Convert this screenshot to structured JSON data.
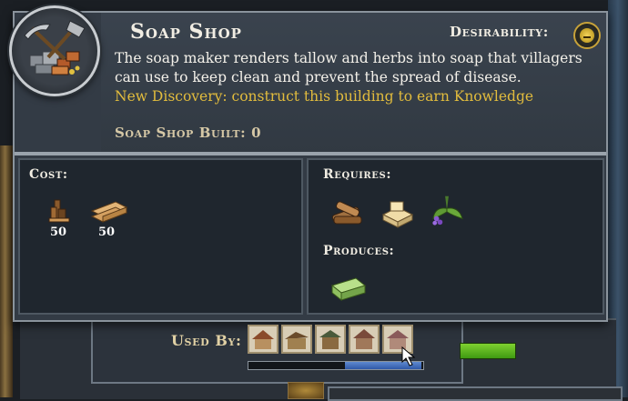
{
  "tooltip": {
    "title": "Soap Shop",
    "desirability_label": "Desirability:",
    "desirability_value": "neutral",
    "description": "The soap maker renders tallow and herbs into soap that villagers can use to keep clean and prevent the spread of disease.",
    "discovery": "New Discovery: construct this building to earn Knowledge",
    "built_label": "Soap Shop Built:",
    "built_count": "0"
  },
  "cost": {
    "label": "Cost:",
    "items": [
      {
        "icon": "wood-logs-icon",
        "amount": "50"
      },
      {
        "icon": "planks-icon",
        "amount": "50"
      }
    ]
  },
  "requires": {
    "label": "Requires:",
    "items": [
      "firewood-icon",
      "tallow-icon",
      "herbs-icon"
    ]
  },
  "produces": {
    "label": "Produces:",
    "items": [
      "soap-icon"
    ]
  },
  "used_by": {
    "label": "Used By:",
    "buildings": [
      "building-1-icon",
      "building-2-icon",
      "building-3-icon",
      "building-4-icon",
      "building-5-icon"
    ],
    "scroll_position": 0.55
  },
  "colors": {
    "discovery": "#e2bc3d",
    "panel_border": "#8a939c",
    "badge_gold": "#c7a23a"
  }
}
